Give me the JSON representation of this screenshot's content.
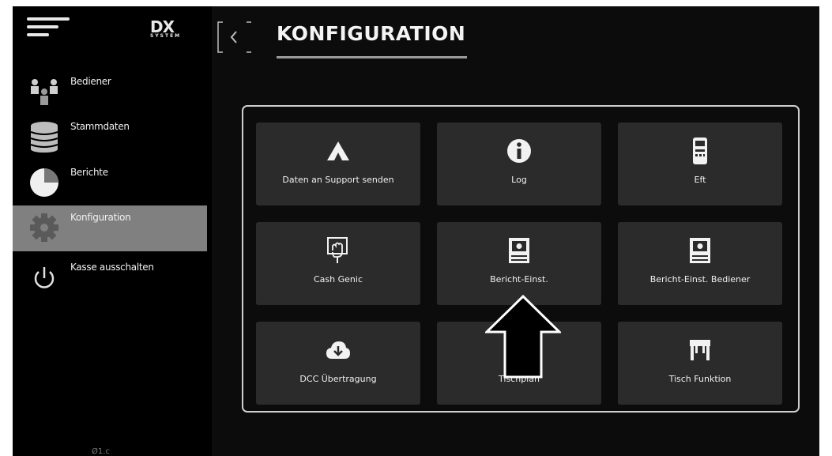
{
  "header": {
    "title": "KONFIGURATION"
  },
  "logo": {
    "main": "DX",
    "sub": "SYSTEM"
  },
  "sidebar": {
    "items": [
      {
        "label": "Bediener",
        "icon": "users-icon"
      },
      {
        "label": "Stammdaten",
        "icon": "database-icon"
      },
      {
        "label": "Berichte",
        "icon": "pie-chart-icon"
      },
      {
        "label": "Konfiguration",
        "icon": "gear-icon",
        "active": true
      },
      {
        "label": "Kasse ausschalten",
        "icon": "power-icon"
      }
    ],
    "footer": "Ø1.c"
  },
  "tiles": [
    {
      "label": "Daten an Support senden",
      "icon": "support-a-icon"
    },
    {
      "label": "Log",
      "icon": "info-icon"
    },
    {
      "label": "Eft",
      "icon": "card-terminal-icon"
    },
    {
      "label": "Cash Genic",
      "icon": "cash-machine-icon"
    },
    {
      "label": "Bericht-Einst.",
      "icon": "report-settings-icon"
    },
    {
      "label": "Bericht-Einst. Bediener",
      "icon": "report-settings-icon"
    },
    {
      "label": "DCC Übertragung",
      "icon": "cloud-download-icon"
    },
    {
      "label": "Tischplan",
      "icon": "table-plan-icon"
    },
    {
      "label": "Tisch Funktion",
      "icon": "table-icon"
    }
  ],
  "colors": {
    "background": "#0c0c0c",
    "sidebar": "#000000",
    "active": "#808080",
    "tile": "#2b2b2b",
    "text": "#f0f0f0"
  }
}
